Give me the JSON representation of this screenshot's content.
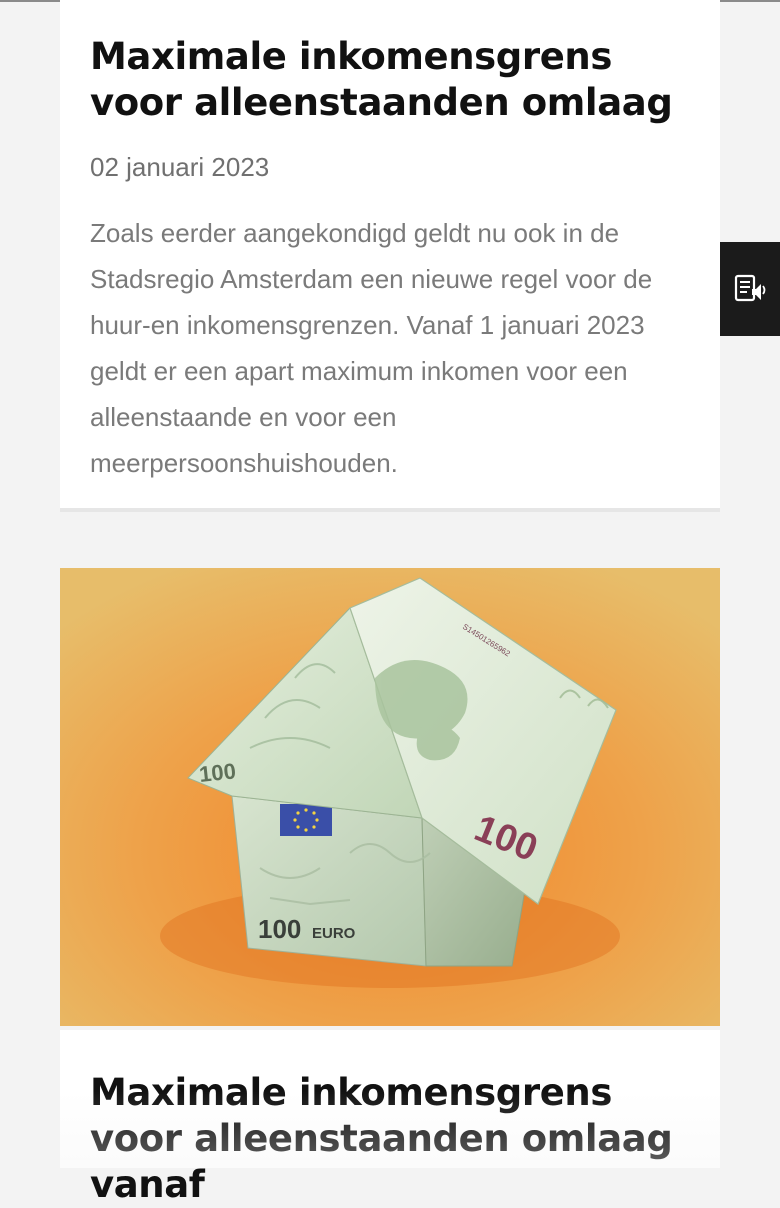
{
  "articles": [
    {
      "title": "Maximale inkomensgrens voor alleenstaanden omlaag",
      "date": "02 januari 2023",
      "summary": "Zoals eerder aangekondigd geldt nu ook in de Stadsregio Amsterdam een nieuwe regel voor de huur-en inkomensgrenzen. Vanaf 1 januari 2023 geldt er een apart maximum inkomen voor een alleenstaande en voor een meerpersoonshuishouden."
    },
    {
      "image_alt": "Huisje gevouwen van 100 euro bankbiljetten",
      "image_text": {
        "roof_note_value": "100",
        "roof_note_serial": "S14501265962",
        "side_note_value": "100",
        "front_note_value": "100",
        "front_note_currency": "EURO"
      },
      "title": "Maximale inkomensgrens voor alleenstaanden omlaag vanaf"
    }
  ],
  "read_aloud": {
    "icon": "read-aloud-icon",
    "color": "#1b1b1b"
  },
  "colors": {
    "page_background": "#f3f3f3",
    "card_background": "#ffffff",
    "title": "#111111",
    "date": "#707070",
    "summary": "#7a7a7a",
    "image_background": "#e9ad55"
  }
}
